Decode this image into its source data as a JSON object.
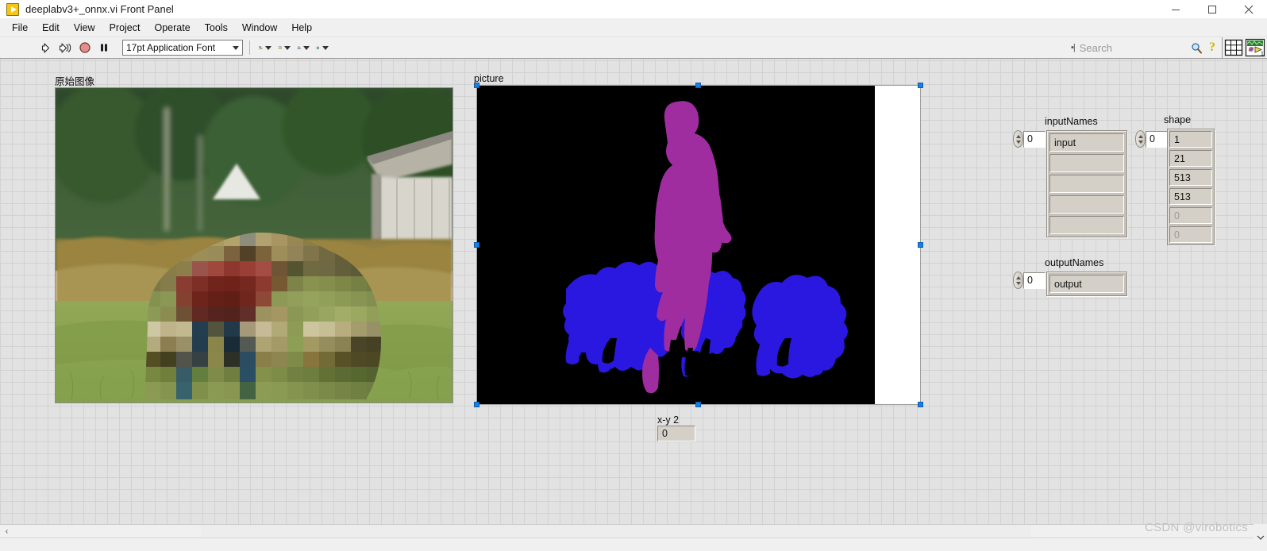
{
  "window": {
    "title": "deeplabv3+_onnx.vi Front Panel",
    "icon": "vi-run-icon",
    "minimize_label": "–",
    "maximize_label": "□",
    "close_label": "×"
  },
  "menu": {
    "items": [
      "File",
      "Edit",
      "View",
      "Project",
      "Operate",
      "Tools",
      "Window",
      "Help"
    ]
  },
  "toolbar": {
    "run_label": "Run",
    "run_continuous_label": "Run Continuously",
    "abort_label": "Abort Execution",
    "pause_label": "Pause",
    "font_selector": "17pt Application Font",
    "align_objects_label": "Align Objects",
    "distribute_objects_label": "Distribute Objects",
    "resize_objects_label": "Resize Objects",
    "reorder_label": "Reorder",
    "search": {
      "placeholder": "Search"
    },
    "help_label": "?",
    "context_help_label": "Context Help",
    "connector_pane_label": "Connector Pane",
    "vi_icon_label": "VI Icon"
  },
  "panel": {
    "original_image": {
      "label": "原始图像"
    },
    "picture": {
      "label": "picture",
      "selected": true
    },
    "xy2": {
      "label": "x-y 2",
      "value": "0"
    },
    "input_names": {
      "label": "inputNames",
      "index": "0",
      "values": [
        "input",
        "",
        "",
        "",
        ""
      ]
    },
    "shape": {
      "label": "shape",
      "index": "0",
      "values": [
        "1",
        "21",
        "513",
        "513",
        "0",
        "0"
      ]
    },
    "output_names": {
      "label": "outputNames",
      "index": "0",
      "values": [
        "output"
      ]
    }
  },
  "statusbar": {
    "watermark": "CSDN @virobotics",
    "scroll_left_label": "‹",
    "scroll_down_label": "∨"
  },
  "colors": {
    "panel_bg": "#e2e2e2",
    "grid_line": "#d2d2d2",
    "selection_handle": "#1a7fe0",
    "seg_person": "#a02da0",
    "seg_dog": "#2a18e0",
    "seg_background": "#000000",
    "control_face": "#d4d0c8",
    "accent_yellow": "#f5c518"
  }
}
